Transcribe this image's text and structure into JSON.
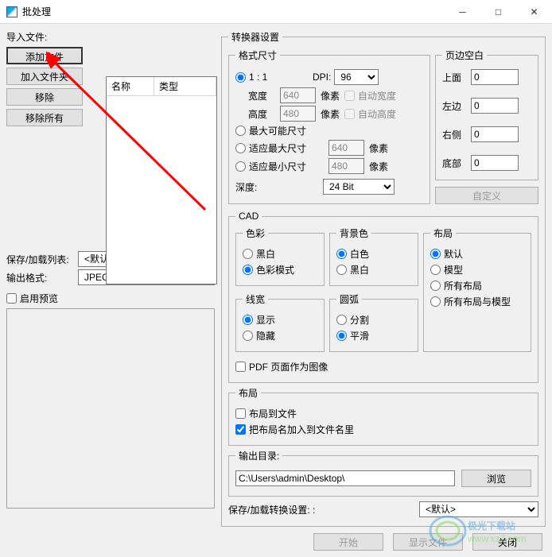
{
  "window": {
    "title": "批处理",
    "min": "─",
    "max": "□",
    "close": "✕"
  },
  "left": {
    "import_label": "导入文件:",
    "add_file": "添加文件",
    "add_folder": "加入文件夹",
    "remove": "移除",
    "remove_all": "移除所有",
    "col_name": "名称",
    "col_type": "类型",
    "save_load_list": "保存/加载列表:",
    "list_default": "<默认>",
    "output_format": "输出格式:",
    "output_format_value": "JPEG (*.jpg)",
    "enable_preview": "启用预览"
  },
  "converter": {
    "legend": "转换器设置",
    "format_size": "格式尺寸",
    "opt_11": "1 : 1",
    "dpi": "DPI:",
    "dpi_value": "96",
    "width": "宽度",
    "width_value": "640",
    "pixel": "像素",
    "auto_width": "自动宽度",
    "height": "高度",
    "height_value": "480",
    "auto_height": "自动高度",
    "max_possible": "最大可能尺寸",
    "fit_max": "适应最大尺寸",
    "fit_max_value": "640",
    "fit_min": "适应最小尺寸",
    "fit_min_value": "480",
    "depth": "深度:",
    "depth_value": "24 Bit",
    "margins": {
      "legend": "页边空白",
      "top": "上面",
      "top_v": "0",
      "left": "左边",
      "left_v": "0",
      "right": "右侧",
      "right_v": "0",
      "bottom": "底部",
      "bottom_v": "0"
    },
    "custom": "自定义"
  },
  "cad": {
    "legend": "CAD",
    "color": {
      "legend": "色彩",
      "bw": "黑白",
      "rgb": "色彩模式"
    },
    "bg": {
      "legend": "背景色",
      "white": "白色",
      "black": "黑白"
    },
    "linew": {
      "legend": "线宽",
      "show": "显示",
      "hide": "隐藏"
    },
    "arc": {
      "legend": "圆弧",
      "split": "分割",
      "smooth": "平滑"
    },
    "layout": {
      "legend": "布局",
      "default": "默认",
      "model": "模型",
      "all": "所有布局",
      "all_model": "所有布局与模型"
    },
    "pdf_as_image": "PDF 页面作为图像"
  },
  "layout2": {
    "legend": "布局",
    "to_file": "布局到文件",
    "to_filename": "把布局名加入到文件名里"
  },
  "output": {
    "legend": "输出目录:",
    "path": "C:\\Users\\admin\\Desktop\\",
    "browse": "浏览"
  },
  "save_load_settings": "保存/加载转换设置: :",
  "settings_default": "<默认>",
  "buttons": {
    "start": "开始",
    "view": "显示文件",
    "close": "关闭"
  },
  "watermark": {
    "site": "极光下载站",
    "url": "www.xz7.com"
  }
}
